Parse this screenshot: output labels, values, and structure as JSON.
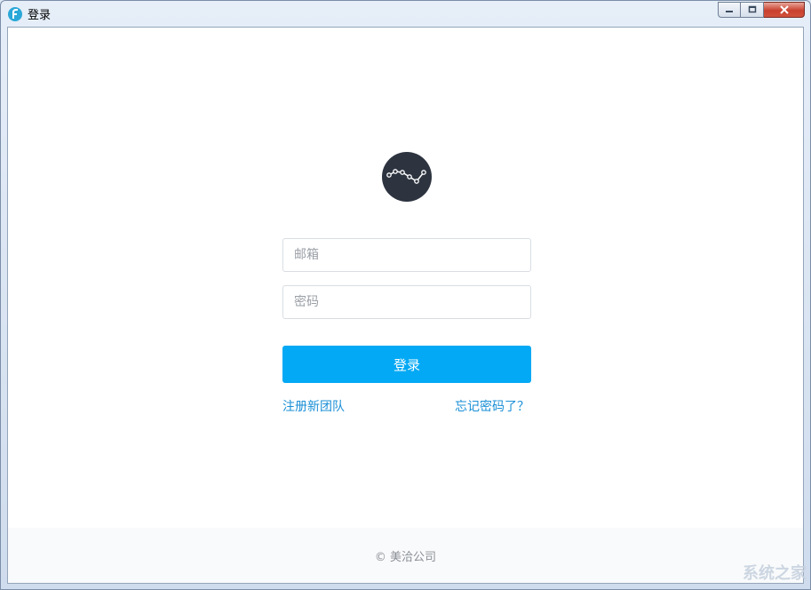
{
  "window": {
    "title": "登录",
    "controls": {
      "minimize": "minimize",
      "maximize": "maximize",
      "close": "close"
    }
  },
  "logo": {
    "icon": "line-chart-logo-icon",
    "color": "#2d3440"
  },
  "form": {
    "email_placeholder": "邮箱",
    "password_placeholder": "密码",
    "login_label": "登录",
    "login_color": "#03a9f4"
  },
  "links": {
    "register": "注册新团队",
    "forgot": "忘记密码了？",
    "color": "#1a8fd6"
  },
  "footer": {
    "copyright": "© 美洽公司"
  },
  "watermark": {
    "text": "系统之家"
  }
}
